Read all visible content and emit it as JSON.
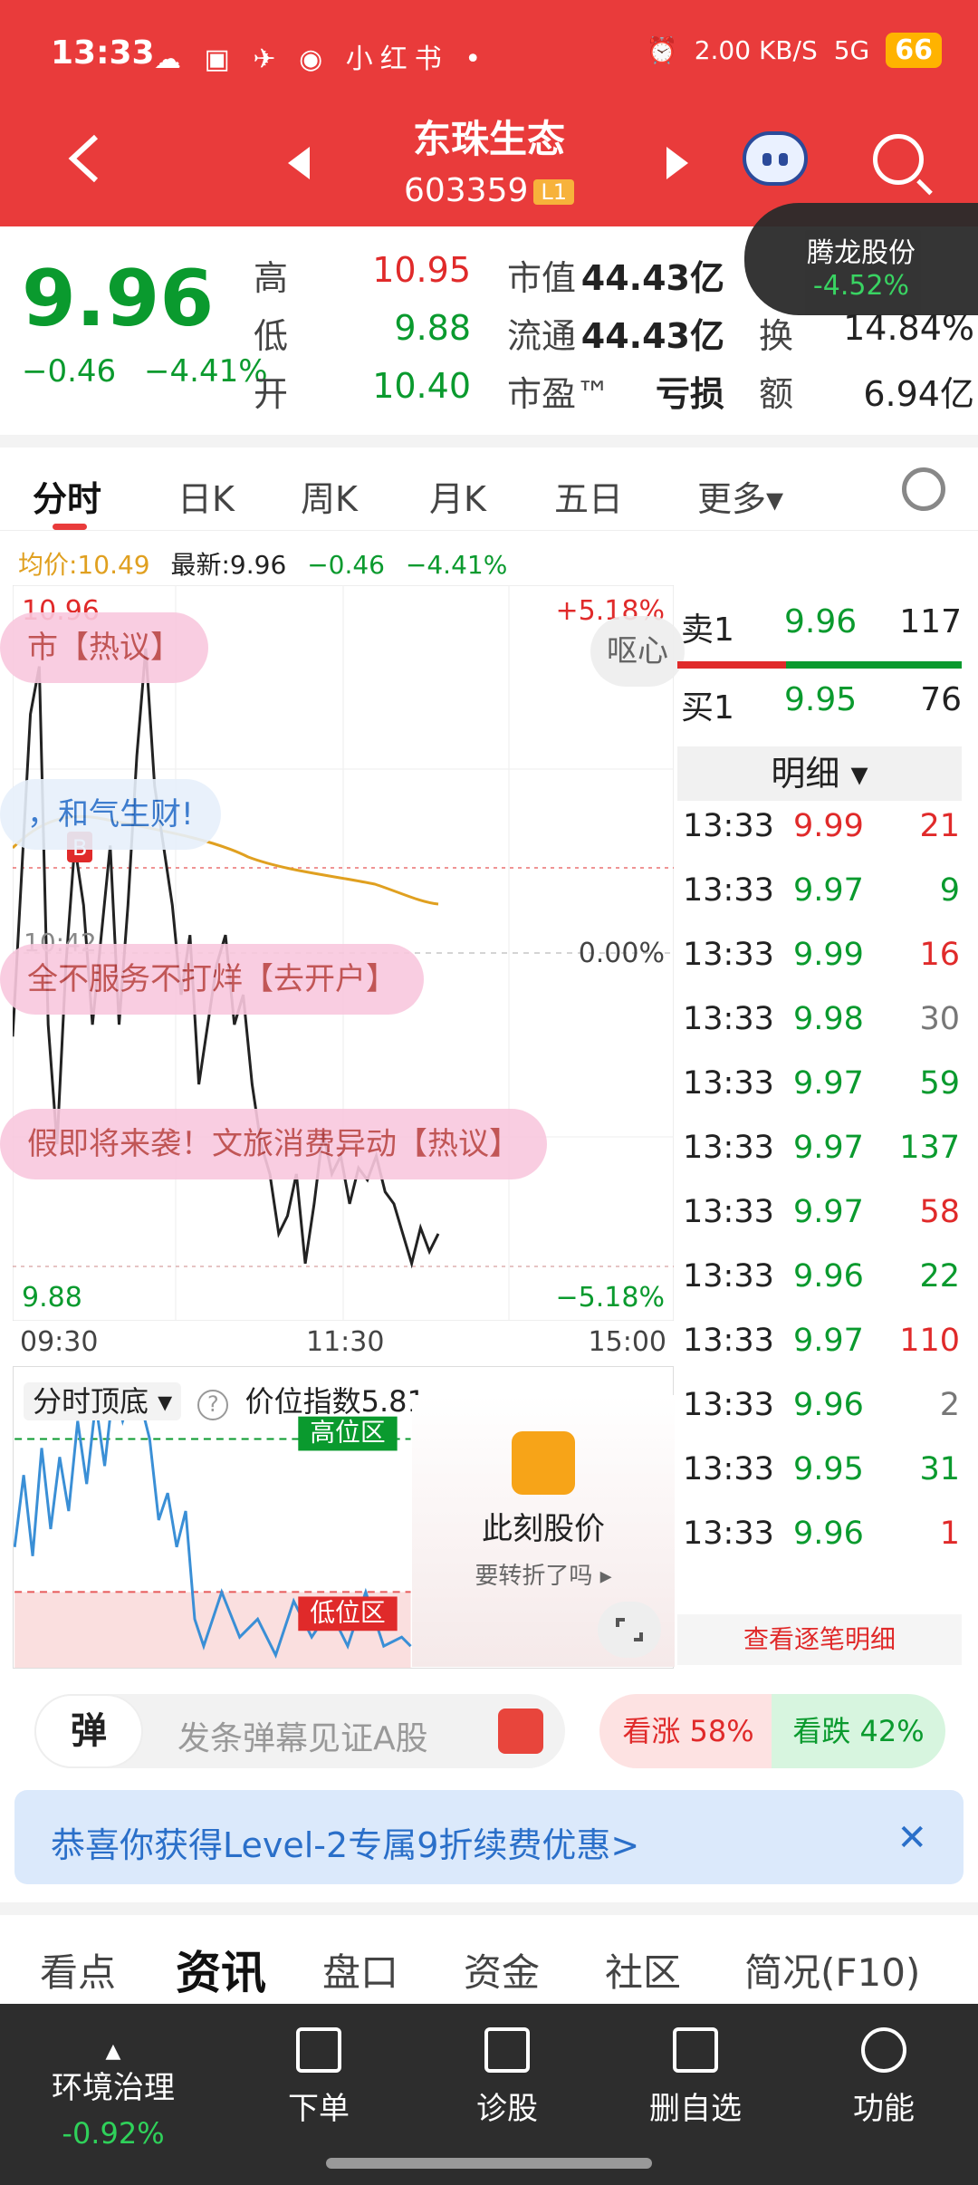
{
  "status_bar": {
    "time": "13:33",
    "icons": "☁ ▣ ✈ ◉ 小红书 •",
    "net": "2.00 KB/S",
    "signal": "5G",
    "battery": "66"
  },
  "header": {
    "stock_name": "东珠生态",
    "code": "603359",
    "level": "L1"
  },
  "quote": {
    "price": "9.96",
    "change": "−0.46",
    "change_pct": "−4.41%",
    "high_label": "高",
    "high": "10.95",
    "low_label": "低",
    "low": "9.88",
    "open_label": "开",
    "open": "10.40",
    "mktcap_label": "市值",
    "mktcap": "44.43亿",
    "float_label": "流通",
    "float": "44.43亿",
    "pe_label": "市盈™",
    "pe": "亏损",
    "turnover_label": "换",
    "turnover": "14.84%",
    "amount_label": "额",
    "amount": "6.94亿"
  },
  "float_tip": {
    "name": "腾龙股份",
    "pct": "-4.52%"
  },
  "tabs": [
    "分时",
    "日K",
    "周K",
    "月K",
    "五日",
    "更多▾"
  ],
  "info_row": {
    "avg": "均价:10.49",
    "latest": "最新:9.96",
    "chg": "−0.46",
    "pct": "−4.41%"
  },
  "chart": {
    "top_price": "10.96",
    "top_pct": "+5.18%",
    "mid_pct": "0.00%",
    "bottom_price": "9.88",
    "bottom_pct": "−5.18%",
    "mid_time_marker": "10:42",
    "times": [
      "09:30",
      "11:30",
      "15:00"
    ],
    "danmu": [
      "市【热议】",
      "，和气生财!",
      "全不服务不打烊【去开户】",
      "假即将来袭！文旅消费异动【热议】",
      "呕心"
    ],
    "price_line": [
      10.28,
      10.55,
      10.82,
      10.9,
      10.3,
      10.1,
      10.4,
      10.6,
      10.5,
      10.3,
      10.45,
      10.6,
      10.3,
      10.5,
      10.75,
      10.93,
      10.7,
      10.6,
      10.5,
      10.35,
      10.45,
      10.2,
      10.3,
      10.4,
      10.45,
      10.3,
      10.35,
      10.2,
      10.1,
      10.05,
      9.95,
      9.98,
      10.05,
      9.9,
      10.0,
      10.12,
      10.05,
      10.08,
      10.0,
      10.06,
      10.04,
      10.08,
      10.02,
      10.0,
      9.95,
      9.9,
      9.96,
      9.92,
      9.95
    ]
  },
  "sub_chart": {
    "title": "分时顶底 ▾",
    "index_label": "价位指数",
    "index_value": "5.81",
    "high_zone": "高位区",
    "low_zone": "低位区"
  },
  "promo": {
    "title": "此刻股价",
    "subtitle": "要转折了吗 ▸"
  },
  "order_book": {
    "sell": {
      "label": "卖1",
      "price": "9.96",
      "vol": "117"
    },
    "buy": {
      "label": "买1",
      "price": "9.95",
      "vol": "76"
    },
    "detail_label": "明细 ▾",
    "trades": [
      {
        "t": "13:33",
        "p": "9.99",
        "v": "21",
        "pc": "red",
        "vc": "red"
      },
      {
        "t": "13:33",
        "p": "9.97",
        "v": "9",
        "pc": "green",
        "vc": "green"
      },
      {
        "t": "13:33",
        "p": "9.99",
        "v": "16",
        "pc": "green",
        "vc": "red"
      },
      {
        "t": "13:33",
        "p": "9.98",
        "v": "30",
        "pc": "green",
        "vc": "gray"
      },
      {
        "t": "13:33",
        "p": "9.97",
        "v": "59",
        "pc": "green",
        "vc": "green"
      },
      {
        "t": "13:33",
        "p": "9.97",
        "v": "137",
        "pc": "green",
        "vc": "green"
      },
      {
        "t": "13:33",
        "p": "9.97",
        "v": "58",
        "pc": "green",
        "vc": "red"
      },
      {
        "t": "13:33",
        "p": "9.96",
        "v": "22",
        "pc": "green",
        "vc": "green"
      },
      {
        "t": "13:33",
        "p": "9.97",
        "v": "110",
        "pc": "green",
        "vc": "red"
      },
      {
        "t": "13:33",
        "p": "9.96",
        "v": "2",
        "pc": "green",
        "vc": "gray"
      },
      {
        "t": "13:33",
        "p": "9.95",
        "v": "31",
        "pc": "green",
        "vc": "green"
      },
      {
        "t": "13:33",
        "p": "9.96",
        "v": "1",
        "pc": "green",
        "vc": "red"
      }
    ],
    "view_all": "查看逐笔明细"
  },
  "bullet": {
    "icon_label": "弹",
    "placeholder": "发条弹幕见证A股",
    "rise": "看涨 58%",
    "fall": "看跌 42%"
  },
  "banner": {
    "text": "恭喜你获得Level-2专属9折续费优惠>",
    "close": "✕"
  },
  "news_tabs": [
    "看点",
    "资讯",
    "盘口",
    "资金",
    "社区",
    "简况(F10)"
  ],
  "bottom_nav": {
    "env_name": "环境治理",
    "env_pct": "-0.92%",
    "items": [
      "下单",
      "诊股",
      "删自选",
      "功能"
    ]
  },
  "colors": {
    "brand": "#e93b3b",
    "up": "#e02a2a",
    "down": "#0a9a2e",
    "avg": "#e0a020"
  }
}
